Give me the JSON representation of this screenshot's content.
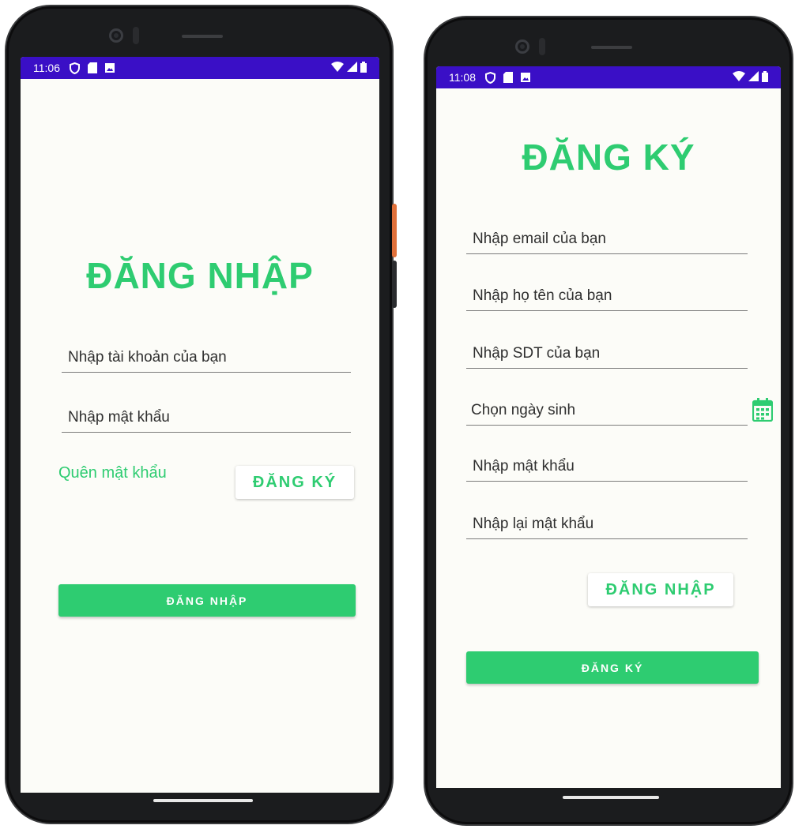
{
  "colors": {
    "accent": "#2ecc71",
    "status_bar": "#3a0fc6",
    "screen_bg": "#fcfcf8",
    "phone_frame": "#1b1c1e"
  },
  "login": {
    "status_time": "11:06",
    "title": "ĐĂNG NHẬP",
    "username_placeholder": "Nhập tài khoản của bạn",
    "password_placeholder": "Nhập mật khẩu",
    "forgot_password": "Quên mật khẩu",
    "register_button": "ĐĂNG KÝ",
    "login_button": "ĐĂNG NHẬP"
  },
  "register": {
    "status_time": "11:08",
    "title": "ĐĂNG KÝ",
    "email_placeholder": "Nhập email của bạn",
    "fullname_placeholder": "Nhập họ tên của bạn",
    "phone_placeholder": "Nhập SDT của bạn",
    "birthdate_placeholder": "Chọn ngày sinh",
    "password_placeholder": "Nhập mật khẩu",
    "confirm_password_placeholder": "Nhập lại mật khẩu",
    "login_button": "ĐĂNG NHẬP",
    "register_button": "ĐĂNG KÝ"
  },
  "icons": {
    "status_left": [
      "shield-icon",
      "sd-card-icon",
      "image-icon"
    ],
    "status_right": [
      "wifi-icon",
      "signal-icon",
      "battery-icon"
    ],
    "date_picker": "calendar-icon"
  }
}
